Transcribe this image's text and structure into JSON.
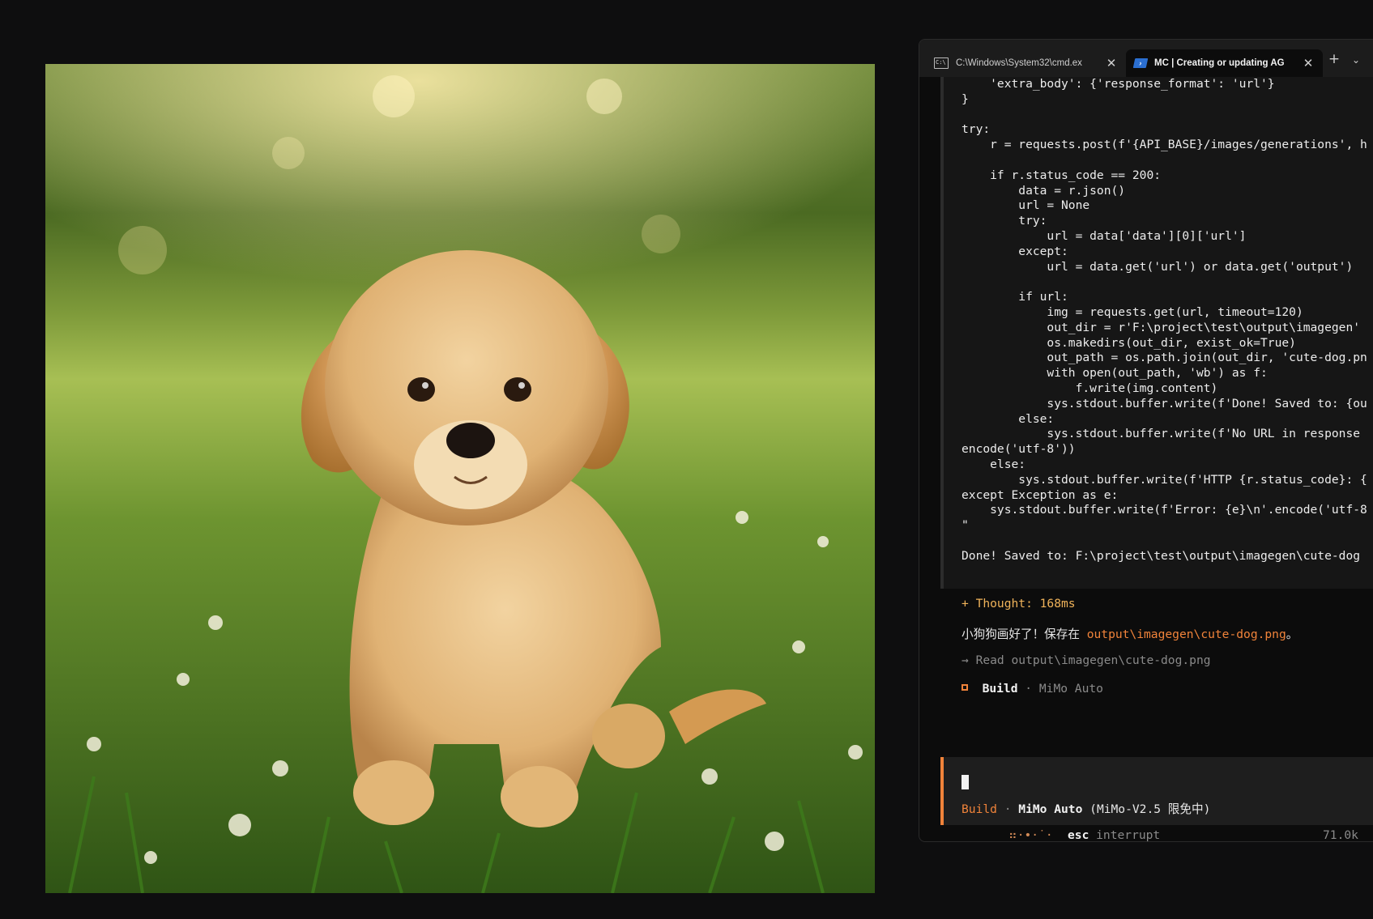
{
  "tabs": [
    {
      "label": "C:\\Windows\\System32\\cmd.ex",
      "icon": "cmd-icon"
    },
    {
      "label": "MC | Creating or updating AG",
      "icon": "powershell-icon"
    }
  ],
  "tab_add_label": "+",
  "tab_dropdown_label": "⌄",
  "code_text": "    'extra_body': {'response_format': 'url'}\n}\n\ntry:\n    r = requests.post(f'{API_BASE}/images/generations', h\n\n    if r.status_code == 200:\n        data = r.json()\n        url = None\n        try:\n            url = data['data'][0]['url']\n        except:\n            url = data.get('url') or data.get('output')\n\n        if url:\n            img = requests.get(url, timeout=120)\n            out_dir = r'F:\\project\\test\\output\\imagegen'\n            os.makedirs(out_dir, exist_ok=True)\n            out_path = os.path.join(out_dir, 'cute-dog.pn\n            with open(out_path, 'wb') as f:\n                f.write(img.content)\n            sys.stdout.buffer.write(f'Done! Saved to: {ou\n        else:\n            sys.stdout.buffer.write(f'No URL in response\nencode('utf-8'))\n    else:\n        sys.stdout.buffer.write(f'HTTP {r.status_code}: {\nexcept Exception as e:\n    sys.stdout.buffer.write(f'Error: {e}\\n'.encode('utf-8\n\"\n\nDone! Saved to: F:\\project\\test\\output\\imagegen\\cute-dog",
  "thought": "+ Thought: 168ms",
  "reply_prefix": "小狗狗画好了！保存在 ",
  "reply_path": "output\\imagegen\\cute-dog.png",
  "reply_suffix": "。",
  "read_line": "→ Read output\\imagegen\\cute-dog.png",
  "build_line": {
    "mode": "Build",
    "sep": " · ",
    "model": "MiMo Auto"
  },
  "input_footer": {
    "mode": "Build",
    "sep": " · ",
    "model": "MiMo Auto",
    "detail": " (MiMo-V2.5 限免中)"
  },
  "status_bar": {
    "spinner": "⠶·•·˙·",
    "key": "esc",
    "action": " interrupt",
    "right": "71.0k"
  },
  "colors": {
    "accent_orange": "#f0833a",
    "thought_gold": "#f0b35a",
    "bg": "#0c0c0c"
  }
}
